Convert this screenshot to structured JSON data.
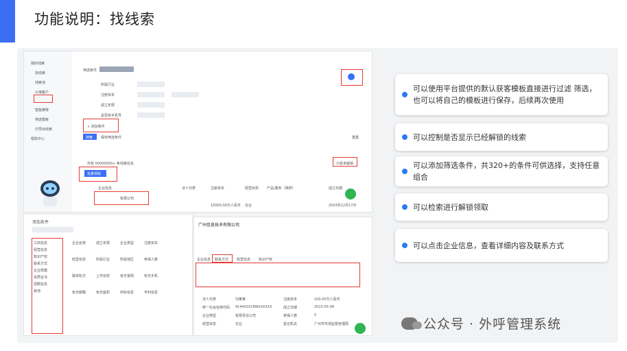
{
  "header": {
    "title": "功能说明：找线索"
  },
  "cards": [
    {
      "text": "可以使用平台提供的默认获客模板直接进行过滤 筛选，也可以将自己的模板进行保存，后续再次使用"
    },
    {
      "text": "可以控制是否显示已经解锁的线索"
    },
    {
      "text": "可以添加筛选条件，共320+的条件可供选择，支持任意组合"
    },
    {
      "text": "可以检索进行解锁领取"
    },
    {
      "text": "可以点击企业信息，查看详细内容及联系方式"
    }
  ],
  "watermark": {
    "text": "公众号 · 外呼管理系统"
  },
  "screen1": {
    "sidebar": [
      "我的线索",
      "找线索",
      "线索池",
      "公海客户",
      "智能推荐",
      "筛选模板",
      "已导出线索",
      "帮助中心"
    ],
    "filter_label": "筛选条件",
    "filter_items": [
      "所属行业",
      "注册资本",
      "成立年限",
      "是否有手机号"
    ],
    "add_condition": "+ 添加条件",
    "buttons": {
      "search": "搜索",
      "save_template": "保存筛选条件",
      "reset": "重置"
    },
    "result_note": "共有 50000000+ 条线索信息",
    "show_unlocked": "只看未解锁",
    "batch_unlock": "批量领取",
    "table_headers": [
      "企业信息",
      "法人代表",
      "注册资本",
      "经营状态",
      "产品/服务（简称）",
      "成立日期"
    ],
    "row": {
      "company": "有限公司",
      "capital": "10000.00万人民币",
      "status": "在业",
      "date": "2003年12月17日"
    }
  },
  "screen2": {
    "title": "添加条件",
    "categories": [
      "工商信息",
      "经营信息",
      "知识产权",
      "联系方式",
      "企业规模",
      "资质证书",
      "招聘信息",
      "其他"
    ],
    "options": [
      "企业名称",
      "成立年限",
      "企业类型",
      "注册资本",
      "经营状态",
      "所属行业",
      "所属地区",
      "参保人数",
      "融资轮次",
      "上市状态",
      "有无官网",
      "有无手机",
      "有无邮箱",
      "有无座机",
      "商标信息",
      "专利信息"
    ]
  },
  "screen3": {
    "company": "广州信息技术有限公司",
    "tabs": [
      "企业信息",
      "联系方式",
      "经营信息",
      "知识产权"
    ],
    "fields": [
      "法人代表",
      "统一社会信用代码",
      "企业类型",
      "经营状态",
      "注册资本",
      "成立日期",
      "参保人数",
      "登记机关"
    ],
    "values": [
      "刘某某",
      "91440101MA5XXXXX",
      "有限责任公司",
      "在业",
      "100.00万人民币",
      "2015-05-06",
      "5",
      "广州市市场监督管理局"
    ]
  },
  "colors": {
    "accent": "#3b6ef5",
    "highlight": "#e53935",
    "dot": "#2b7bf0"
  }
}
